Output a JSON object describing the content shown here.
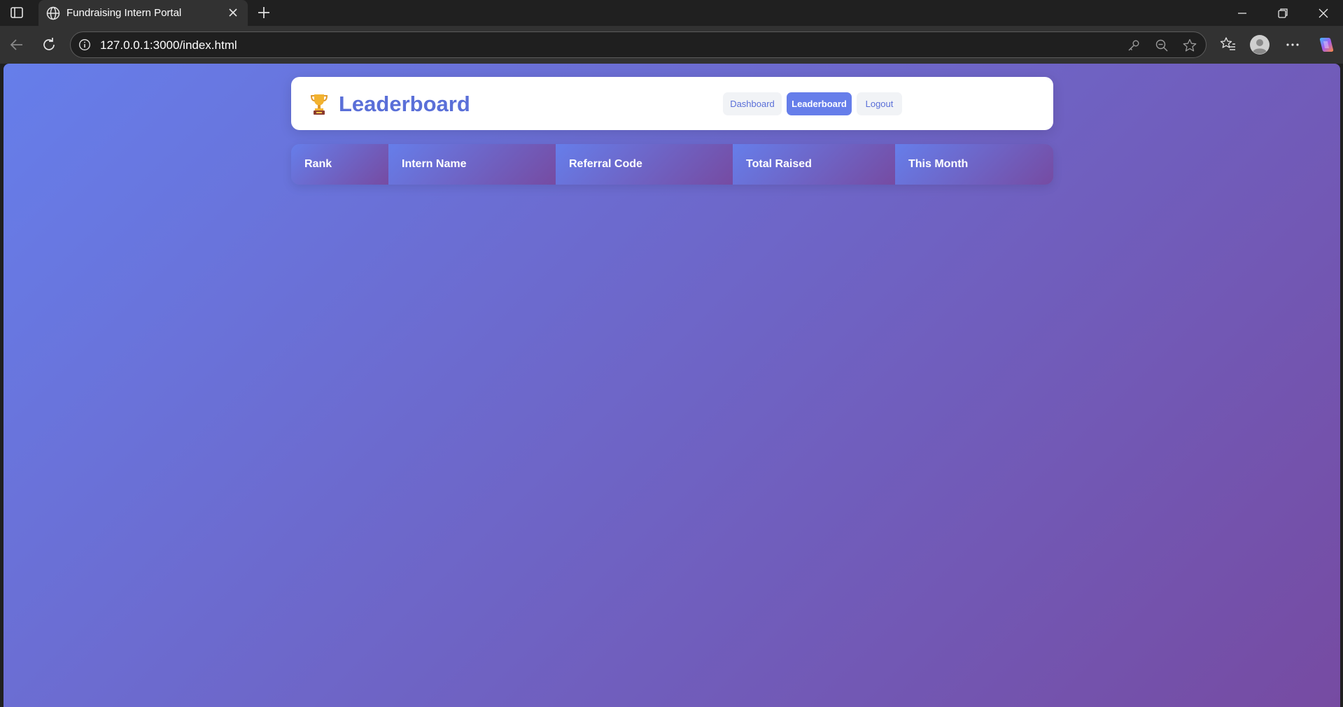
{
  "browser": {
    "tab_title": "Fundraising Intern Portal",
    "url": "127.0.0.1:3000/index.html"
  },
  "header": {
    "title": "Leaderboard",
    "title_icon": "trophy-icon",
    "nav": {
      "dashboard": "Dashboard",
      "leaderboard": "Leaderboard",
      "logout": "Logout"
    },
    "active_nav": "leaderboard"
  },
  "table": {
    "columns": [
      "Rank",
      "Intern Name",
      "Referral Code",
      "Total Raised",
      "This Month"
    ],
    "rows": []
  },
  "colors": {
    "gradient_start": "#667eea",
    "gradient_end": "#764ba2",
    "accent": "#5a6fd8",
    "active_button": "#667eea"
  }
}
